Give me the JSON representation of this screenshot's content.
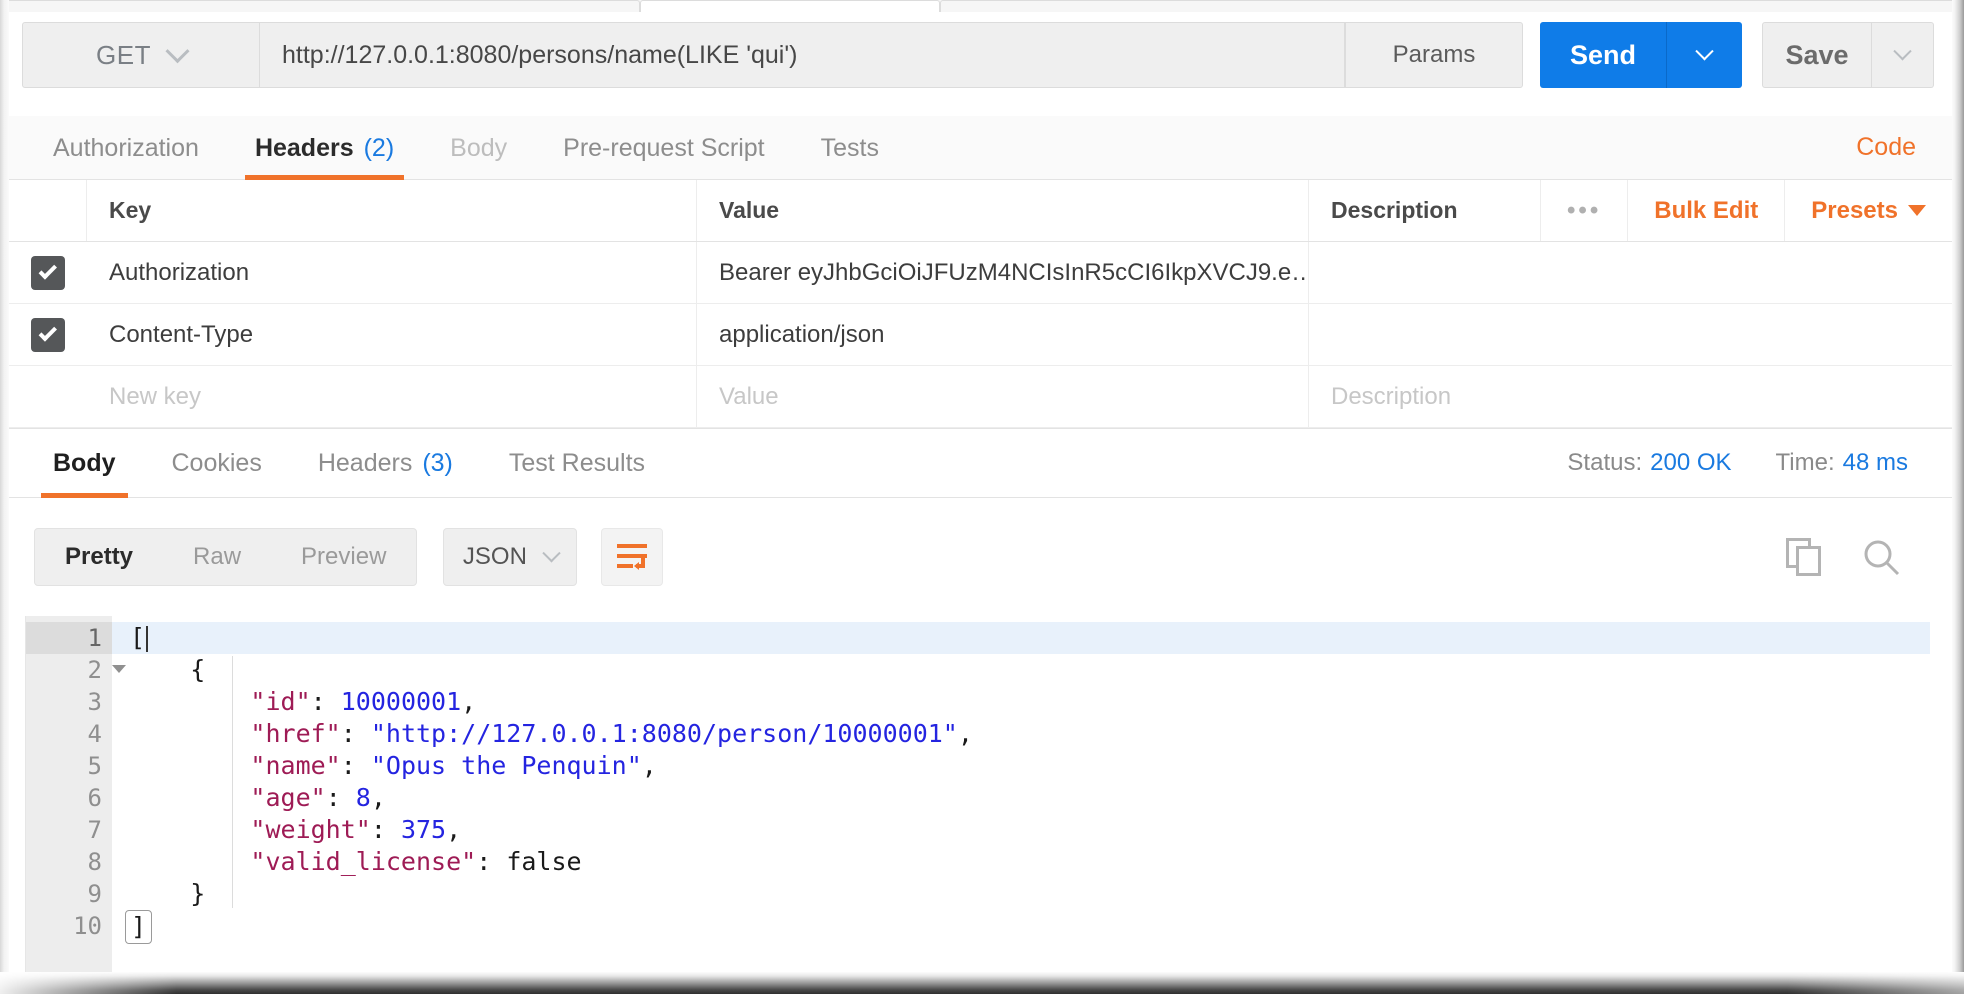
{
  "request": {
    "method": "GET",
    "url": "http://127.0.0.1:8080/persons/name(LIKE 'qui')",
    "params_label": "Params",
    "send_label": "Send",
    "save_label": "Save",
    "code_link": "Code",
    "tabs": [
      {
        "label": "Authorization",
        "count": "",
        "state": "normal"
      },
      {
        "label": "Headers",
        "count": "(2)",
        "state": "active"
      },
      {
        "label": "Body",
        "count": "",
        "state": "disabled"
      },
      {
        "label": "Pre-request Script",
        "count": "",
        "state": "normal"
      },
      {
        "label": "Tests",
        "count": "",
        "state": "normal"
      }
    ]
  },
  "headers_table": {
    "columns": {
      "key": "Key",
      "value": "Value",
      "description": "Description"
    },
    "tools": {
      "more": "•••",
      "bulk_edit": "Bulk Edit",
      "presets": "Presets"
    },
    "rows": [
      {
        "checked": true,
        "key": "Authorization",
        "value": "Bearer eyJhbGciOiJFUzM4NCIsInR5cCI6IkpXVCJ9.e…",
        "description": ""
      },
      {
        "checked": true,
        "key": "Content-Type",
        "value": "application/json",
        "description": ""
      }
    ],
    "new_row": {
      "key_placeholder": "New key",
      "value_placeholder": "Value",
      "description_placeholder": "Description"
    }
  },
  "response": {
    "tabs": [
      {
        "label": "Body",
        "count": "",
        "state": "active"
      },
      {
        "label": "Cookies",
        "count": "",
        "state": "normal"
      },
      {
        "label": "Headers",
        "count": "(3)",
        "state": "normal"
      },
      {
        "label": "Test Results",
        "count": "",
        "state": "normal"
      }
    ],
    "status_label": "Status:",
    "status_value": "200 OK",
    "time_label": "Time:",
    "time_value": "48 ms",
    "view_modes": [
      {
        "label": "Pretty",
        "state": "active"
      },
      {
        "label": "Raw",
        "state": "normal"
      },
      {
        "label": "Preview",
        "state": "normal"
      }
    ],
    "format": "JSON",
    "icons": {
      "wrap": "word-wrap-icon",
      "copy": "copy-icon",
      "search": "search-icon"
    },
    "body_lines": [
      {
        "num": "1",
        "foldable": true,
        "current": true,
        "indent": 0,
        "tokens": [
          {
            "t": "p",
            "v": "["
          }
        ],
        "caret": true
      },
      {
        "num": "2",
        "foldable": true,
        "current": false,
        "indent": 1,
        "tokens": [
          {
            "t": "p",
            "v": "{"
          }
        ]
      },
      {
        "num": "3",
        "foldable": false,
        "current": false,
        "indent": 2,
        "tokens": [
          {
            "t": "k",
            "v": "\"id\""
          },
          {
            "t": "p",
            "v": ": "
          },
          {
            "t": "n",
            "v": "10000001"
          },
          {
            "t": "p",
            "v": ","
          }
        ]
      },
      {
        "num": "4",
        "foldable": false,
        "current": false,
        "indent": 2,
        "tokens": [
          {
            "t": "k",
            "v": "\"href\""
          },
          {
            "t": "p",
            "v": ": "
          },
          {
            "t": "s",
            "v": "\"http://127.0.0.1:8080/person/10000001\""
          },
          {
            "t": "p",
            "v": ","
          }
        ]
      },
      {
        "num": "5",
        "foldable": false,
        "current": false,
        "indent": 2,
        "tokens": [
          {
            "t": "k",
            "v": "\"name\""
          },
          {
            "t": "p",
            "v": ": "
          },
          {
            "t": "s",
            "v": "\"Opus the Penquin\""
          },
          {
            "t": "p",
            "v": ","
          }
        ]
      },
      {
        "num": "6",
        "foldable": false,
        "current": false,
        "indent": 2,
        "tokens": [
          {
            "t": "k",
            "v": "\"age\""
          },
          {
            "t": "p",
            "v": ": "
          },
          {
            "t": "n",
            "v": "8"
          },
          {
            "t": "p",
            "v": ","
          }
        ]
      },
      {
        "num": "7",
        "foldable": false,
        "current": false,
        "indent": 2,
        "tokens": [
          {
            "t": "k",
            "v": "\"weight\""
          },
          {
            "t": "p",
            "v": ": "
          },
          {
            "t": "n",
            "v": "375"
          },
          {
            "t": "p",
            "v": ","
          }
        ]
      },
      {
        "num": "8",
        "foldable": false,
        "current": false,
        "indent": 2,
        "tokens": [
          {
            "t": "k",
            "v": "\"valid_license\""
          },
          {
            "t": "p",
            "v": ": "
          },
          {
            "t": "b",
            "v": "false"
          }
        ]
      },
      {
        "num": "9",
        "foldable": false,
        "current": false,
        "indent": 1,
        "tokens": [
          {
            "t": "p",
            "v": "}"
          }
        ]
      },
      {
        "num": "10",
        "foldable": false,
        "current": false,
        "indent": 0,
        "tokens": [
          {
            "t": "p",
            "v": "]",
            "box": true
          }
        ]
      }
    ]
  },
  "colors": {
    "accent_orange": "#f0722a",
    "send_blue": "#0f7ce8",
    "link_blue": "#1a7ae0",
    "json_key": "#9e1b55",
    "json_string": "#2424e0"
  }
}
